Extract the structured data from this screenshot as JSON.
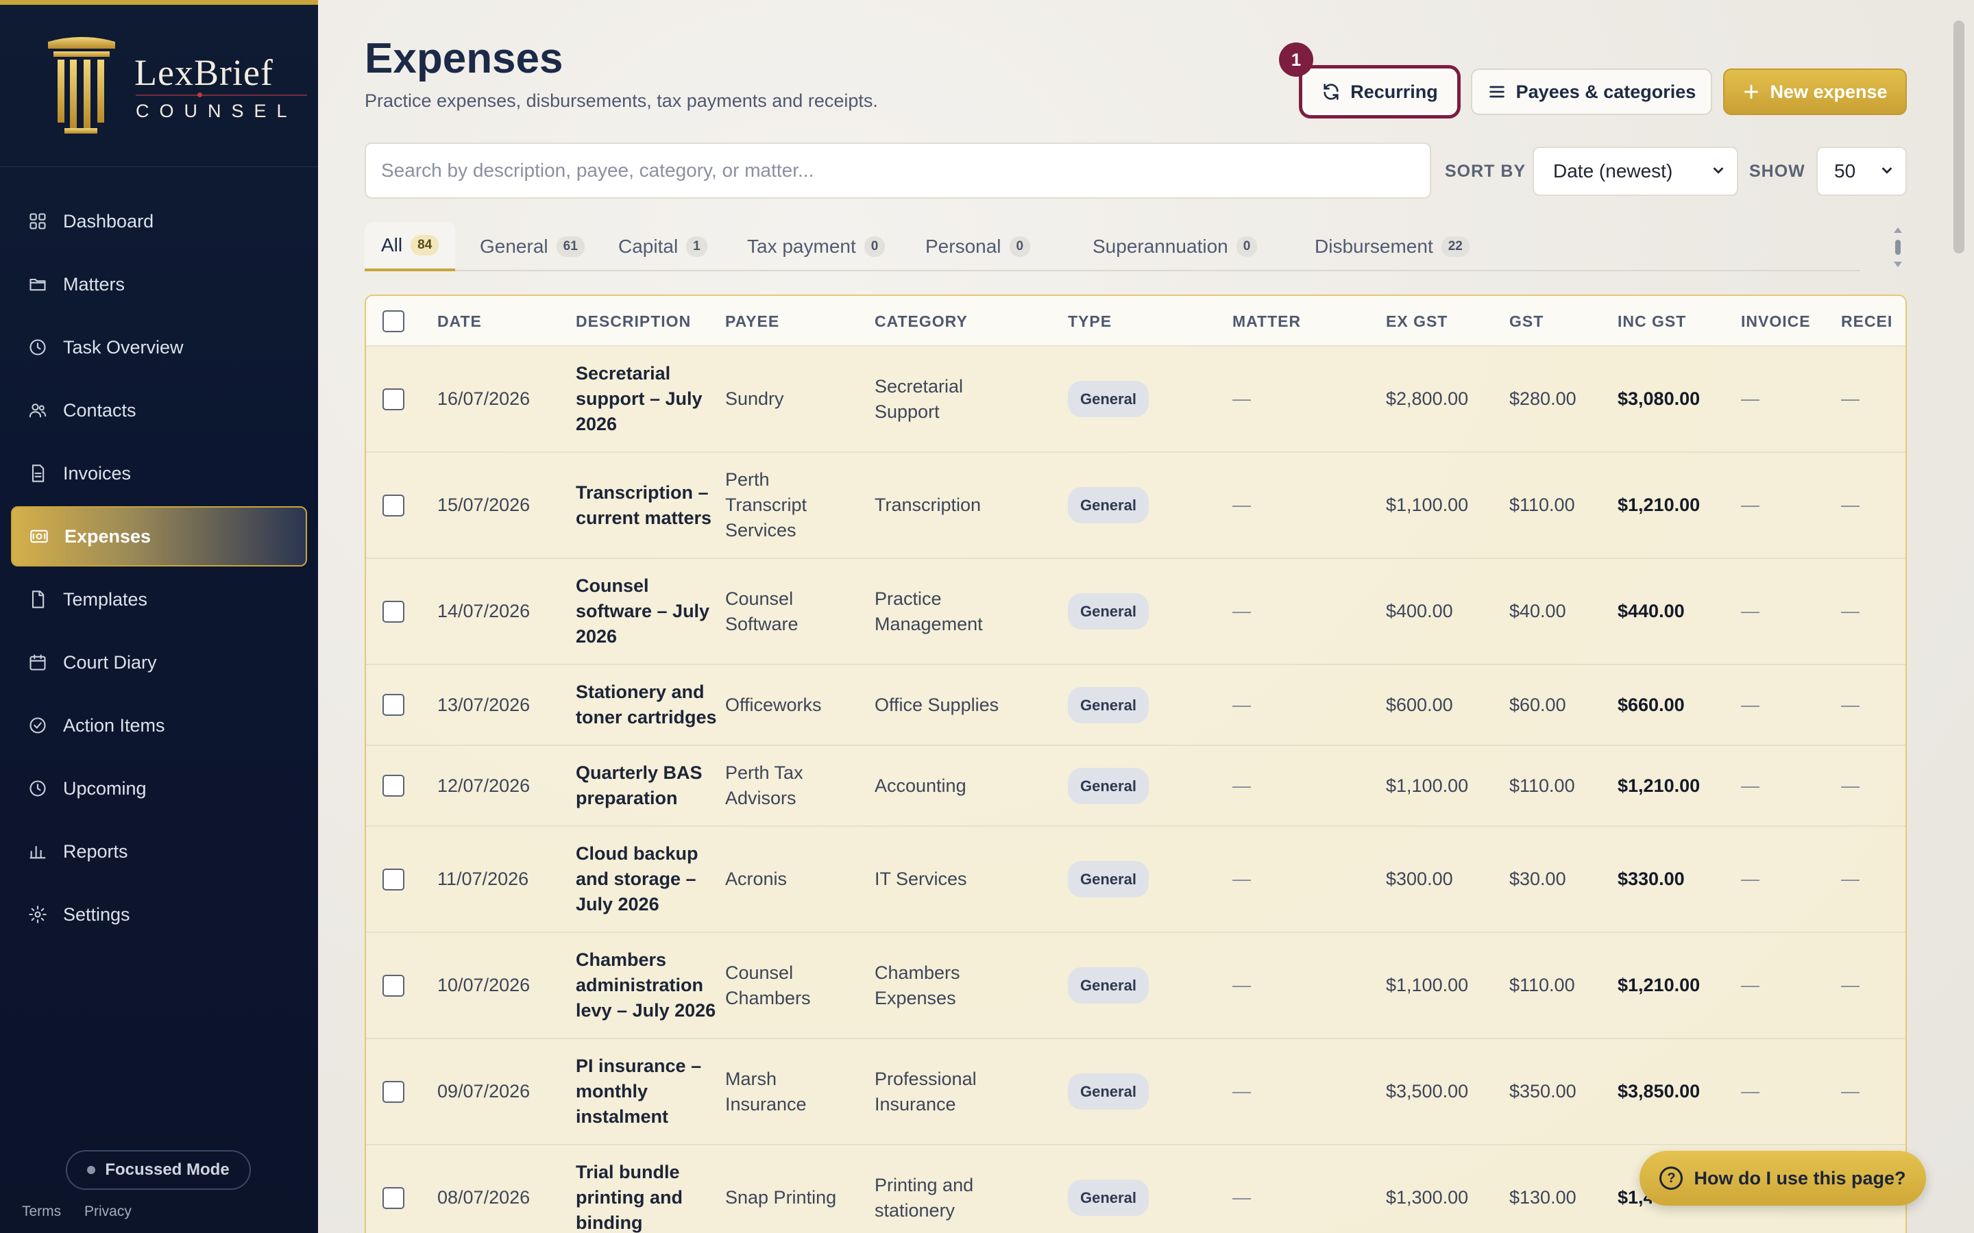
{
  "brand": {
    "name": "LexBrief",
    "sub": "COUNSEL"
  },
  "sidebar": {
    "items": [
      {
        "label": "Dashboard",
        "icon": "grid-icon"
      },
      {
        "label": "Matters",
        "icon": "folder-icon"
      },
      {
        "label": "Task Overview",
        "icon": "clock-icon"
      },
      {
        "label": "Contacts",
        "icon": "users-icon"
      },
      {
        "label": "Invoices",
        "icon": "document-icon"
      },
      {
        "label": "Expenses",
        "icon": "wallet-icon",
        "active": true
      },
      {
        "label": "Templates",
        "icon": "file-icon"
      },
      {
        "label": "Court Diary",
        "icon": "calendar-icon"
      },
      {
        "label": "Action Items",
        "icon": "check-circle-icon"
      },
      {
        "label": "Upcoming",
        "icon": "clock-icon"
      },
      {
        "label": "Reports",
        "icon": "bar-chart-icon"
      },
      {
        "label": "Settings",
        "icon": "gear-icon"
      }
    ],
    "focus_mode": "Focussed Mode",
    "footer": {
      "terms": "Terms",
      "privacy": "Privacy"
    }
  },
  "header": {
    "title": "Expenses",
    "subtitle": "Practice expenses, disbursements, tax payments and receipts.",
    "badge": "1",
    "recurring_label": "Recurring",
    "payees_label": "Payees & categories",
    "new_label": "New expense"
  },
  "search": {
    "placeholder": "Search by description, payee, category, or matter..."
  },
  "sort": {
    "label": "SORT BY",
    "value": "Date (newest)"
  },
  "show": {
    "label": "SHOW",
    "value": "50"
  },
  "tabs": [
    {
      "label": "All",
      "count": "84"
    },
    {
      "label": "General",
      "count": "61"
    },
    {
      "label": "Capital",
      "count": "1"
    },
    {
      "label": "Tax payment",
      "count": "0"
    },
    {
      "label": "Personal",
      "count": "0"
    },
    {
      "label": "Superannuation",
      "count": "0"
    },
    {
      "label": "Disbursement",
      "count": "22"
    }
  ],
  "table": {
    "columns": [
      "DATE",
      "DESCRIPTION",
      "PAYEE",
      "CATEGORY",
      "TYPE",
      "MATTER",
      "EX GST",
      "GST",
      "INC GST",
      "INVOICE",
      "RECEI"
    ],
    "rows": [
      {
        "date": "16/07/2026",
        "description": [
          "Secretarial",
          "support – July",
          "2026"
        ],
        "payee": [
          "Sundry"
        ],
        "category": [
          "Secretarial",
          "Support"
        ],
        "type": "General",
        "matter": "—",
        "ex": "$2,800.00",
        "gst": "$280.00",
        "inc": "$3,080.00",
        "invoice": "—",
        "receipt": "—"
      },
      {
        "date": "15/07/2026",
        "description": [
          "Transcription –",
          "current matters"
        ],
        "payee": [
          "Perth",
          "Transcript",
          "Services"
        ],
        "category": [
          "Transcription"
        ],
        "type": "General",
        "matter": "—",
        "ex": "$1,100.00",
        "gst": "$110.00",
        "inc": "$1,210.00",
        "invoice": "—",
        "receipt": "—"
      },
      {
        "date": "14/07/2026",
        "description": [
          "Counsel",
          "software – July",
          "2026"
        ],
        "payee": [
          "Counsel",
          "Software"
        ],
        "category": [
          "Practice",
          "Management"
        ],
        "type": "General",
        "matter": "—",
        "ex": "$400.00",
        "gst": "$40.00",
        "inc": "$440.00",
        "invoice": "—",
        "receipt": "—"
      },
      {
        "date": "13/07/2026",
        "description": [
          "Stationery and",
          "toner cartridges"
        ],
        "payee": [
          "Officeworks"
        ],
        "category": [
          "Office Supplies"
        ],
        "type": "General",
        "matter": "—",
        "ex": "$600.00",
        "gst": "$60.00",
        "inc": "$660.00",
        "invoice": "—",
        "receipt": "—"
      },
      {
        "date": "12/07/2026",
        "description": [
          "Quarterly BAS",
          "preparation"
        ],
        "payee": [
          "Perth Tax",
          "Advisors"
        ],
        "category": [
          "Accounting"
        ],
        "type": "General",
        "matter": "—",
        "ex": "$1,100.00",
        "gst": "$110.00",
        "inc": "$1,210.00",
        "invoice": "—",
        "receipt": "—"
      },
      {
        "date": "11/07/2026",
        "description": [
          "Cloud backup",
          "and storage –",
          "July 2026"
        ],
        "payee": [
          "Acronis"
        ],
        "category": [
          "IT Services"
        ],
        "type": "General",
        "matter": "—",
        "ex": "$300.00",
        "gst": "$30.00",
        "inc": "$330.00",
        "invoice": "—",
        "receipt": "—"
      },
      {
        "date": "10/07/2026",
        "description": [
          "Chambers",
          "administration",
          "levy – July 2026"
        ],
        "payee": [
          "Counsel",
          "Chambers"
        ],
        "category": [
          "Chambers",
          "Expenses"
        ],
        "type": "General",
        "matter": "—",
        "ex": "$1,100.00",
        "gst": "$110.00",
        "inc": "$1,210.00",
        "invoice": "—",
        "receipt": "—"
      },
      {
        "date": "09/07/2026",
        "description": [
          "PI insurance –",
          "monthly",
          "instalment"
        ],
        "payee": [
          "Marsh",
          "Insurance"
        ],
        "category": [
          "Professional",
          "Insurance"
        ],
        "type": "General",
        "matter": "—",
        "ex": "$3,500.00",
        "gst": "$350.00",
        "inc": "$3,850.00",
        "invoice": "—",
        "receipt": "—"
      },
      {
        "date": "08/07/2026",
        "description": [
          "Trial bundle",
          "printing and",
          "binding"
        ],
        "payee": [
          "Snap Printing"
        ],
        "category": [
          "Printing and",
          "stationery"
        ],
        "type": "General",
        "matter": "—",
        "ex": "$1,300.00",
        "gst": "$130.00",
        "inc": "$1,430.00",
        "invoice": "—",
        "receipt": "—"
      }
    ]
  },
  "help": {
    "label": "How do I use this page?"
  }
}
